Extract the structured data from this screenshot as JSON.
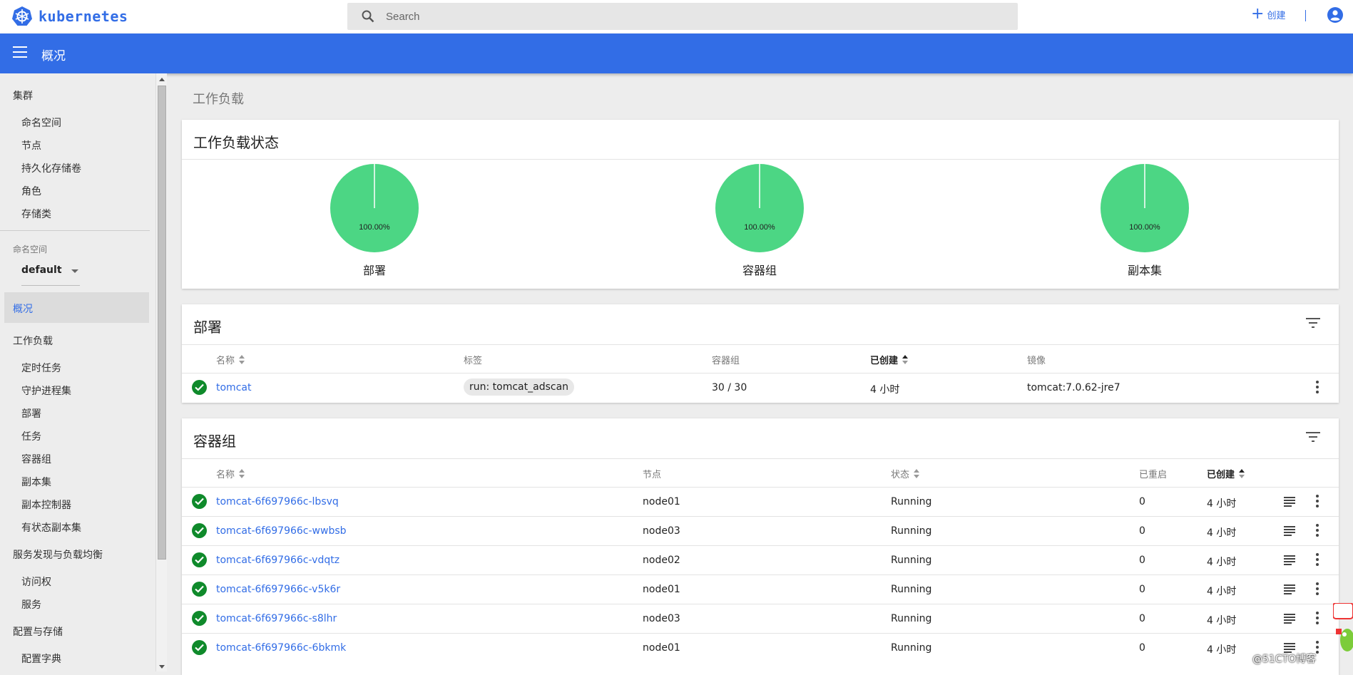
{
  "app": {
    "name": "kubernetes"
  },
  "search": {
    "placeholder": "Search"
  },
  "topbar": {
    "create_label": "创建"
  },
  "header": {
    "title": "概况"
  },
  "sidebar": {
    "cluster": {
      "title": "集群",
      "items": [
        "命名空间",
        "节点",
        "持久化存储卷",
        "角色",
        "存储类"
      ]
    },
    "namespace": {
      "label": "命名空间",
      "selected": "default"
    },
    "overview": "概况",
    "workloads": {
      "title": "工作负载",
      "items": [
        "定时任务",
        "守护进程集",
        "部署",
        "任务",
        "容器组",
        "副本集",
        "副本控制器",
        "有状态副本集"
      ]
    },
    "discovery": {
      "title": "服务发现与负载均衡",
      "items": [
        "访问权",
        "服务"
      ]
    },
    "config": {
      "title": "配置与存储",
      "items": [
        "配置字典"
      ]
    }
  },
  "main": {
    "page_title": "工作负载",
    "status_card": {
      "title": "工作负载状态",
      "pies": [
        {
          "label": "部署",
          "percent_text": "100.00%",
          "fraction": 1.0
        },
        {
          "label": "容器组",
          "percent_text": "100.00%",
          "fraction": 1.0
        },
        {
          "label": "副本集",
          "percent_text": "100.00%",
          "fraction": 1.0
        }
      ]
    },
    "deployments": {
      "title": "部署",
      "headers": {
        "name": "名称",
        "labels": "标签",
        "pods": "容器组",
        "created": "已创建",
        "image": "镜像"
      },
      "rows": [
        {
          "name": "tomcat",
          "label": "run: tomcat_adscan",
          "pods": "30 / 30",
          "created": "4 小时",
          "image": "tomcat:7.0.62-jre7"
        }
      ]
    },
    "pods": {
      "title": "容器组",
      "headers": {
        "name": "名称",
        "node": "节点",
        "status": "状态",
        "restarts": "已重启",
        "created": "已创建"
      },
      "rows": [
        {
          "name": "tomcat-6f697966c-lbsvq",
          "node": "node01",
          "status": "Running",
          "restarts": "0",
          "created": "4 小时"
        },
        {
          "name": "tomcat-6f697966c-wwbsb",
          "node": "node03",
          "status": "Running",
          "restarts": "0",
          "created": "4 小时"
        },
        {
          "name": "tomcat-6f697966c-vdqtz",
          "node": "node02",
          "status": "Running",
          "restarts": "0",
          "created": "4 小时"
        },
        {
          "name": "tomcat-6f697966c-v5k6r",
          "node": "node01",
          "status": "Running",
          "restarts": "0",
          "created": "4 小时"
        },
        {
          "name": "tomcat-6f697966c-s8lhr",
          "node": "node03",
          "status": "Running",
          "restarts": "0",
          "created": "4 小时"
        },
        {
          "name": "tomcat-6f697966c-6bkmk",
          "node": "node01",
          "status": "Running",
          "restarts": "0",
          "created": "4 小时"
        }
      ]
    }
  },
  "watermark": "@51CTO博客",
  "colors": {
    "brand": "#326de6",
    "pie_green": "#4cd684",
    "ok_green": "#0f8a2b"
  }
}
